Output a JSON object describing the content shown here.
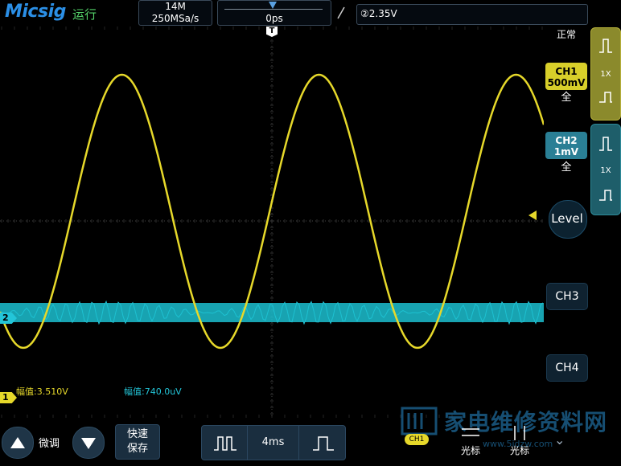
{
  "header": {
    "logo": "Micsig",
    "run_status": "运行",
    "memory_depth": "14M",
    "sample_rate": "250MSa/s",
    "horizontal_position": "0ps",
    "trigger_level": "②2.35V"
  },
  "right_panel": {
    "acq_mode": "正常",
    "ch1": {
      "label": "CH1",
      "scale": "500mV",
      "coupling": "全",
      "probe": "1X"
    },
    "ch2": {
      "label": "CH2",
      "scale": "1mV",
      "coupling": "全",
      "probe": "1X"
    },
    "level_label": "Level",
    "ch3_label": "CH3",
    "ch4_label": "CH4"
  },
  "markers": {
    "ch1": "1",
    "ch2": "2",
    "trigger_pos": "T"
  },
  "measurements": {
    "ch1_amplitude": "幅值:3.510V",
    "ch2_amplitude": "幅值:740.0uV"
  },
  "bottom_bar": {
    "fine_label": "微调",
    "save_label": "快速\n保存",
    "timebase": "4ms",
    "channel_tag": "CH1",
    "cursor1_label": "光标",
    "cursor2_label": "光标"
  },
  "watermark": {
    "text": "家电维修资料网",
    "url": "www.5idzw.com"
  },
  "colors": {
    "ch1": "#e6d82a",
    "ch2": "#23c5d8",
    "logo": "#2b8fe6",
    "run": "#55d36a"
  },
  "icons": {
    "trigger_slope": "rising-edge-icon",
    "up": "triangle-up-icon",
    "down": "triangle-down-icon",
    "timebase_dec": "wide-pulse-icon",
    "timebase_inc": "narrow-pulse-icon"
  }
}
